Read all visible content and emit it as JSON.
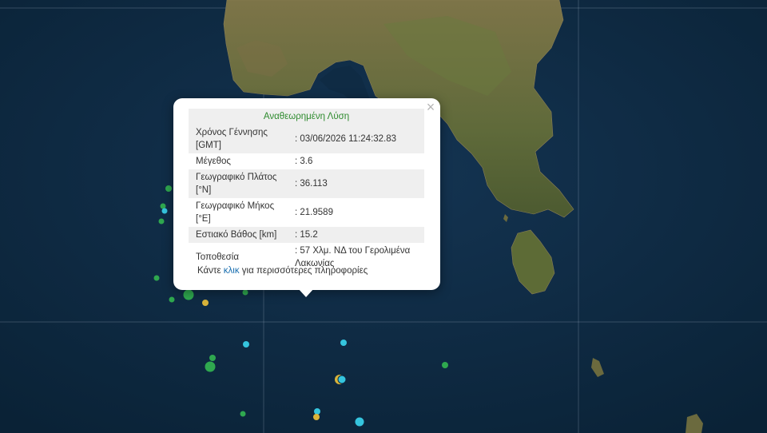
{
  "popup": {
    "title": "Αναθεωρημένη Λύση",
    "close_label": "×",
    "rows": [
      {
        "label": "Χρόνος Γέννησης [GMT]",
        "value": ": 03/06/2026 11:24:32.83"
      },
      {
        "label": "Μέγεθος",
        "value": ": 3.6"
      },
      {
        "label": "Γεωγραφικό Πλάτος [°N]",
        "value": ": 36.113"
      },
      {
        "label": "Γεωγραφικό Μήκος [°E]",
        "value": ": 21.9589"
      },
      {
        "label": "Εστιακό Βάθος [km]",
        "value": ": 15.2"
      },
      {
        "label": "Τοποθεσία",
        "value": ": 57 Χλμ. ΝΔ του Γερολιμένα Λακωνίας"
      }
    ],
    "more_prefix": "Κάντε ",
    "more_link": "κλικ",
    "more_suffix": " για περισσότερες πληροφορίες"
  },
  "colors": {
    "sea": "#0e2a42",
    "land": "#6b6a3e",
    "marker_green": "#2fa84f",
    "marker_cyan": "#35c5de",
    "marker_yellow": "#d9b43a",
    "title_green": "#2e8b2e",
    "link_blue": "#1a6fb0"
  }
}
